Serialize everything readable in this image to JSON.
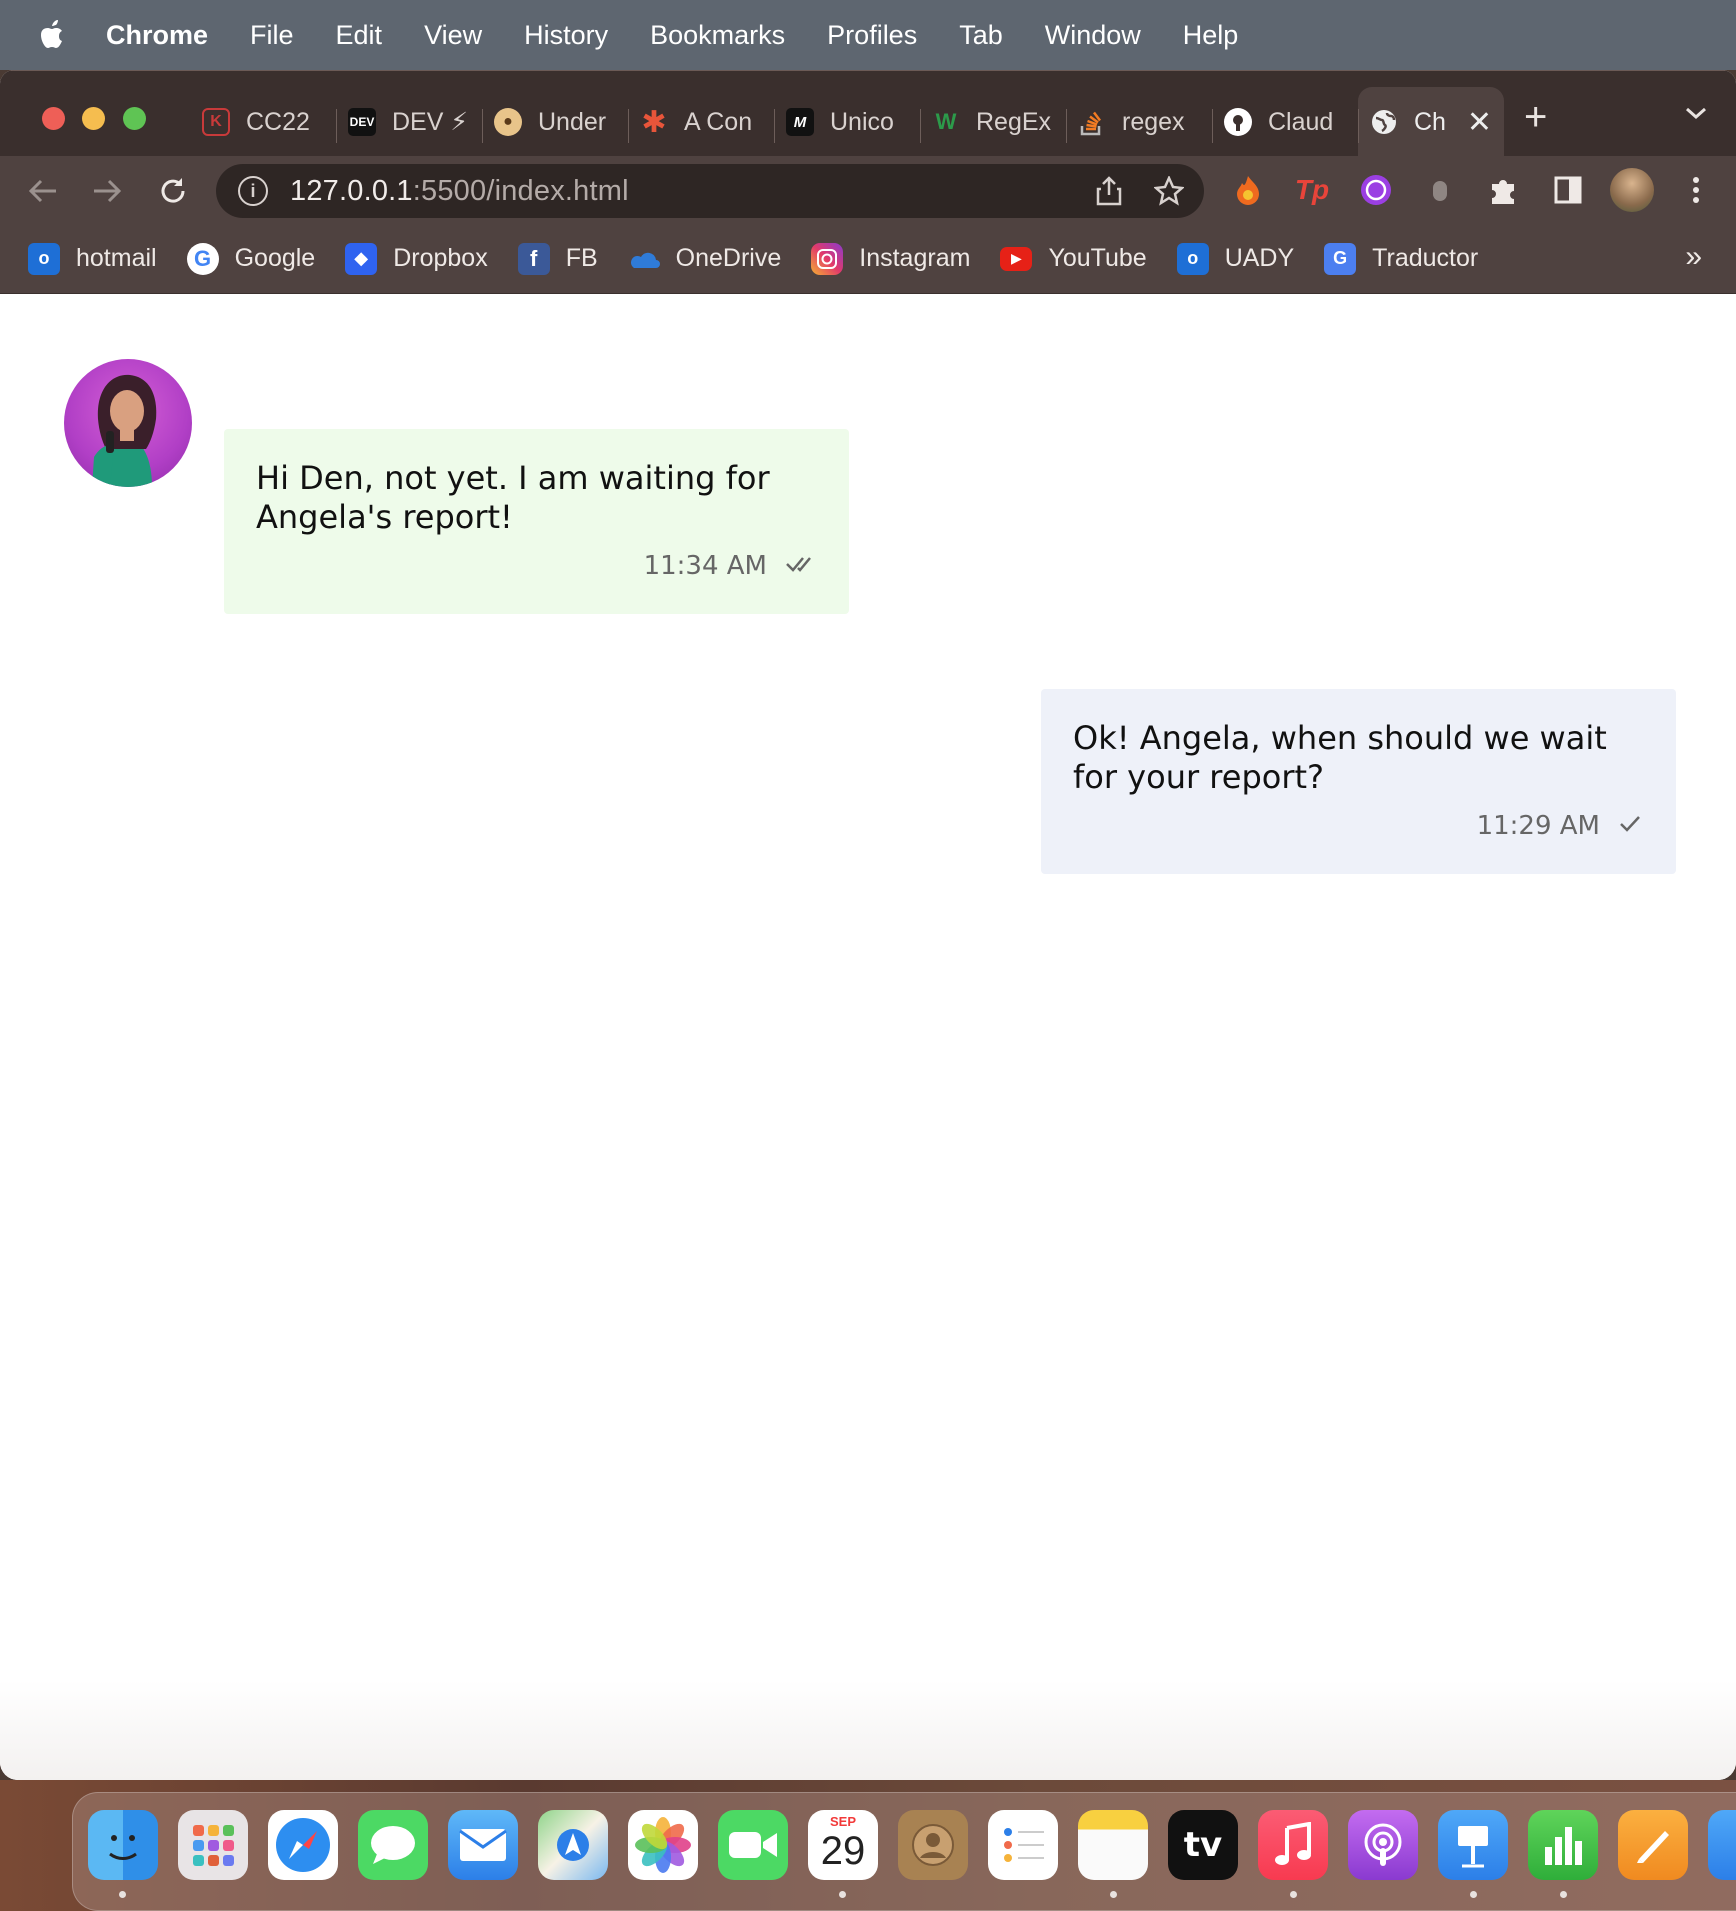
{
  "menubar": {
    "app": "Chrome",
    "items": [
      "File",
      "Edit",
      "View",
      "History",
      "Bookmarks",
      "Profiles",
      "Tab",
      "Window",
      "Help"
    ]
  },
  "tabs": [
    {
      "title": "CC22",
      "icon": "kaggle-shield-icon",
      "color": "#c83a3a"
    },
    {
      "title": "DEV ⚡ ⛓ .",
      "icon": "dev-icon",
      "color": "#111111"
    },
    {
      "title": "Under",
      "icon": "dog-icon",
      "color": "#d8a45c"
    },
    {
      "title": "A Con",
      "icon": "asterisk-icon",
      "color": "#e8553a"
    },
    {
      "title": "Unico",
      "icon": "m-logo-icon",
      "color": "#111111"
    },
    {
      "title": "RegEx",
      "icon": "w3-icon",
      "color": "#2c9a4a"
    },
    {
      "title": "regex",
      "icon": "stackoverflow-icon",
      "color": "#f27b23"
    },
    {
      "title": "Claud",
      "icon": "github-icon",
      "color": "#ffffff"
    },
    {
      "title": "Ch",
      "icon": "globe-icon",
      "color": "#ffffff",
      "active": true
    }
  ],
  "address": {
    "host": "127.0.0.1",
    "rest": ":5500/index.html"
  },
  "bookmarks": [
    {
      "label": "hotmail",
      "icon": "outlook-icon",
      "color": "#1e6fd6"
    },
    {
      "label": "Google",
      "icon": "google-icon",
      "color": "#ffffff"
    },
    {
      "label": "Dropbox",
      "icon": "dropbox-icon",
      "color": "#2f63f0"
    },
    {
      "label": "FB",
      "icon": "facebook-icon",
      "color": "#3b5998"
    },
    {
      "label": "OneDrive",
      "icon": "onedrive-icon",
      "color": "#2f7bd8"
    },
    {
      "label": "Instagram",
      "icon": "instagram-icon",
      "color": "#d3307e"
    },
    {
      "label": "YouTube",
      "icon": "youtube-icon",
      "color": "#e62117"
    },
    {
      "label": "UADY",
      "icon": "outlook-icon",
      "color": "#1e6fd6"
    },
    {
      "label": "Traductor",
      "icon": "translate-icon",
      "color": "#4c7ff0"
    }
  ],
  "bookmarks_more": "»",
  "chat": {
    "incoming": {
      "text": "Hi Den, not yet. I am waiting for Angela's report!",
      "time": "11:34 AM",
      "status": "double-check-icon"
    },
    "outgoing": {
      "text": "Ok! Angela, when should we wait for your report?",
      "time": "11:29 AM",
      "status": "check-icon"
    }
  },
  "dock": {
    "calendar_month": "SEP",
    "calendar_day": "29",
    "tv_label": "tv"
  }
}
